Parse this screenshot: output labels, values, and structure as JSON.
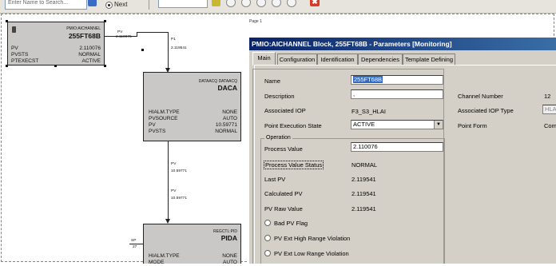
{
  "toolbar": {
    "search_placeholder": "Enter Name to Search...",
    "next_label": "Next",
    "combo_value": "",
    "close_glyph": "✖"
  },
  "canvas": {
    "page_label": "Page 1"
  },
  "block1": {
    "header": "PMIO:AICHANNEL",
    "name": "255FT68B",
    "rows": [
      {
        "label": "PV",
        "value": "2.110076"
      },
      {
        "label": "PVSTS",
        "value": "NORMAL"
      },
      {
        "label": "PTEXECST",
        "value": "ACTIVE"
      }
    ],
    "out_label": "PV",
    "out_value": "2.110076"
  },
  "daca": {
    "header": "DATAACQ DATAACQ",
    "name": "DACA",
    "rows": [
      {
        "label": "HIALM.TYPE",
        "value": "NONE"
      },
      {
        "label": "PVSOURCE",
        "value": "AUTO"
      },
      {
        "label": "PV",
        "value": "10.59771"
      },
      {
        "label": "PVSTS",
        "value": "NORMAL"
      }
    ],
    "in_label": "P1",
    "in_value": "2.119541"
  },
  "conn2": {
    "label1": "PV",
    "value1": "10.59771",
    "label2": "PV",
    "value2": "10.59771"
  },
  "pida": {
    "header": "REGCTL:PID",
    "name": "PIDA",
    "rows": [
      {
        "label": "HIALM.TYPE",
        "value": "NONE"
      },
      {
        "label": "MODE",
        "value": "AUTO"
      }
    ],
    "sp_label": "SP",
    "sp_value": "27"
  },
  "dialog": {
    "title": "PMIO:AICHANNEL Block, 255FT68B - Parameters [Monitoring]",
    "tabs": [
      "Main",
      "Configuration",
      "Identification",
      "Dependencies",
      "Template Defining"
    ],
    "active_tab": "Main",
    "name_label": "Name",
    "name_value": "255FT68B",
    "description_label": "Description",
    "description_value": ",",
    "assoc_iop_label": "Associated IOP",
    "assoc_iop_value": "F3_S3_HLAI",
    "pes_label": "Point Execution State",
    "pes_value": "ACTIVE",
    "channel_number_label": "Channel Number",
    "channel_number_value": "12",
    "iop_type_label": "Associated IOP Type",
    "iop_type_value": "HLAI",
    "point_form_label": "Point Form",
    "point_form_value": "Comp",
    "operation_group": "Operation",
    "process_value_label": "Process Value",
    "process_value_value": "2.110076",
    "pvs_label": "Process Value Status",
    "pvs_value": "NORMAL",
    "last_pv_label": "Last PV",
    "last_pv_value": "2.119541",
    "calc_pv_label": "Calculated PV",
    "calc_pv_value": "2.119541",
    "raw_pv_label": "PV Raw Value",
    "raw_pv_value": "2.119541",
    "bad_pv_label": "Bad PV Flag",
    "ext_high_label": "PV Ext High Range Violation",
    "ext_low_label": "PV Ext Low Range Violation"
  }
}
